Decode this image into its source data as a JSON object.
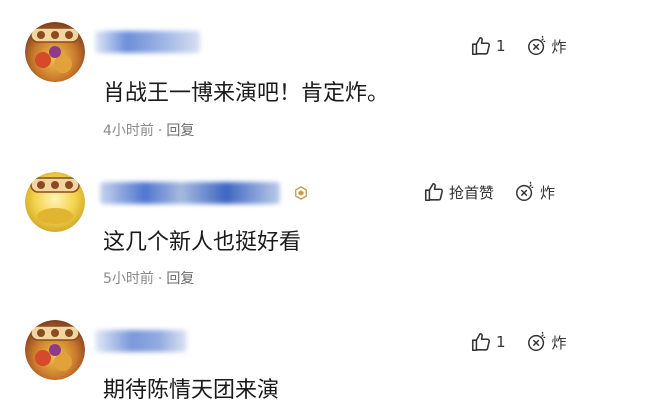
{
  "comments": [
    {
      "text": "肖战王一博来演吧！肯定炸。",
      "time": "4小时前",
      "sep": "·",
      "reply": "回复",
      "like_count": "1",
      "bomb_label": "炸"
    },
    {
      "text": "这几个新人也挺好看",
      "time": "5小时前",
      "sep": "·",
      "reply": "回复",
      "like_label": "抢首赞",
      "bomb_label": "炸"
    },
    {
      "text": "期待陈情天团来演",
      "like_count": "1",
      "bomb_label": "炸"
    }
  ],
  "colors": {
    "blur_blue": "#5b82d6",
    "avatar_gold": "#e0b62c",
    "badge_gold": "#c9974a"
  },
  "icons": [
    "thumbs-up-icon",
    "bomb-icon",
    "badge-icon"
  ]
}
